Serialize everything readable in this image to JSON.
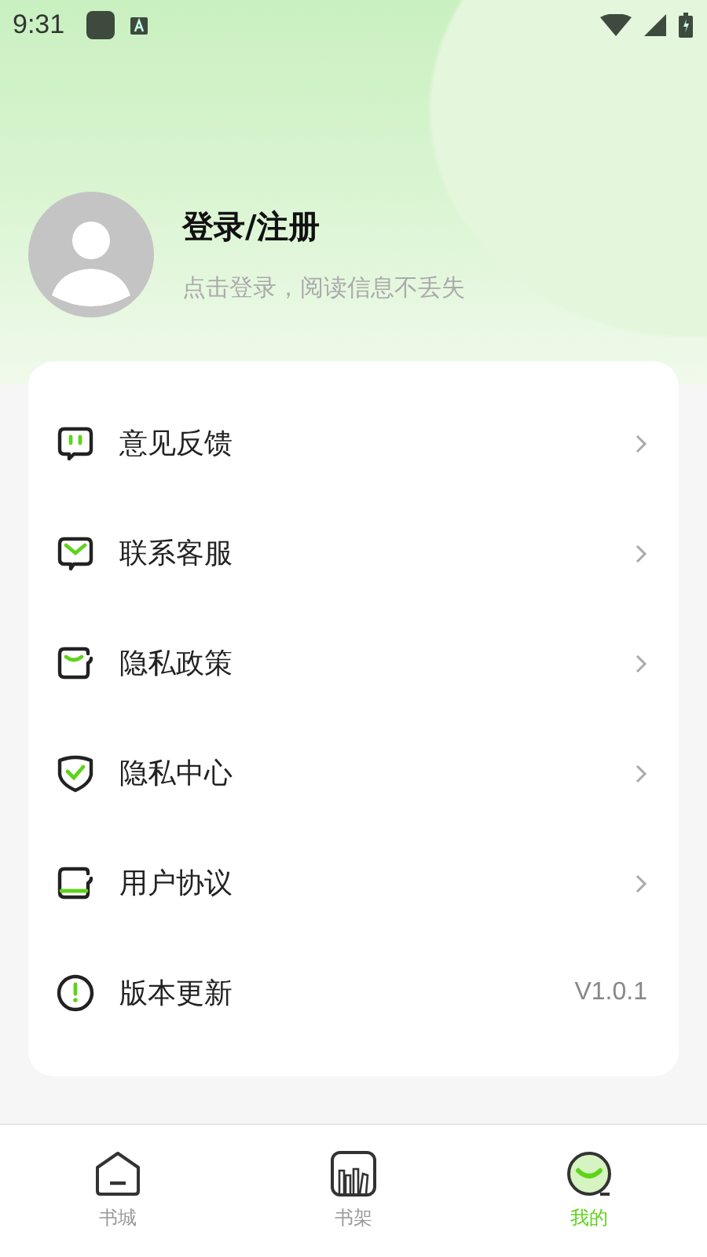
{
  "status_bar": {
    "time": "9:31"
  },
  "profile": {
    "title": "登录/注册",
    "subtitle": "点击登录，阅读信息不丢失"
  },
  "menu": [
    {
      "kind": "feedback",
      "label": "意见反馈"
    },
    {
      "kind": "service",
      "label": "联系客服"
    },
    {
      "kind": "policy",
      "label": "隐私政策"
    },
    {
      "kind": "shield",
      "label": "隐私中心"
    },
    {
      "kind": "agreement",
      "label": "用户协议"
    },
    {
      "kind": "update",
      "label": "版本更新",
      "value": "V1.0.1"
    }
  ],
  "bottom_nav": [
    {
      "kind": "home",
      "label": "书城",
      "selected": false
    },
    {
      "kind": "shelf",
      "label": "书架",
      "selected": false
    },
    {
      "kind": "me",
      "label": "我的",
      "selected": true
    }
  ]
}
